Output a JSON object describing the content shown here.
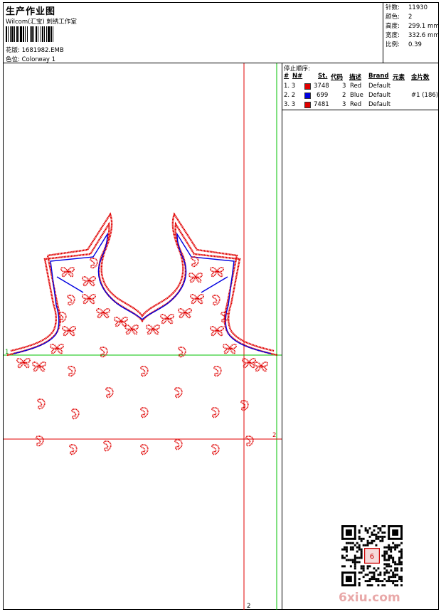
{
  "header": {
    "title": "生产作业图",
    "company": "Wilcom(汇宝) 刺绣工作室",
    "design_label": "花版:",
    "design_value": "1681982.EMB",
    "colorway_label": "色位:",
    "colorway_value": "Colorway 1"
  },
  "stats": [
    {
      "label": "针数:",
      "value": "11930"
    },
    {
      "label": "颜色:",
      "value": "2"
    },
    {
      "label": "高度:",
      "value": "299.1 mm"
    },
    {
      "label": "宽度:",
      "value": "332.6 mm"
    },
    {
      "label": "比例:",
      "value": "0.39"
    }
  ],
  "stop_sequence": {
    "title": "停止顺序:",
    "headers": [
      "#",
      "N#",
      "St.",
      "代码",
      "描述",
      "Brand",
      "元素",
      "金片数"
    ],
    "rows": [
      {
        "num": "1. 3",
        "color": "#e00000",
        "st": "3748",
        "code": "3",
        "desc": "Red",
        "brand": "Default",
        "element": "",
        "sequins": ""
      },
      {
        "num": "2. 2",
        "color": "#0000e0",
        "st": "699",
        "code": "2",
        "desc": "Blue",
        "brand": "Default",
        "element": "#1 (186)",
        "sequins": ""
      },
      {
        "num": "3. 3",
        "color": "#e00000",
        "st": "7481",
        "code": "3",
        "desc": "Red",
        "brand": "Default",
        "element": "",
        "sequins": ""
      }
    ]
  },
  "guides": {
    "label_1": "1",
    "label_2a": "2",
    "label_2b": "2"
  },
  "watermark": "6xiu.com",
  "colors": {
    "red": "#e00000",
    "blue": "#0000e0",
    "green": "#00c000",
    "guide_red": "#e00000"
  }
}
